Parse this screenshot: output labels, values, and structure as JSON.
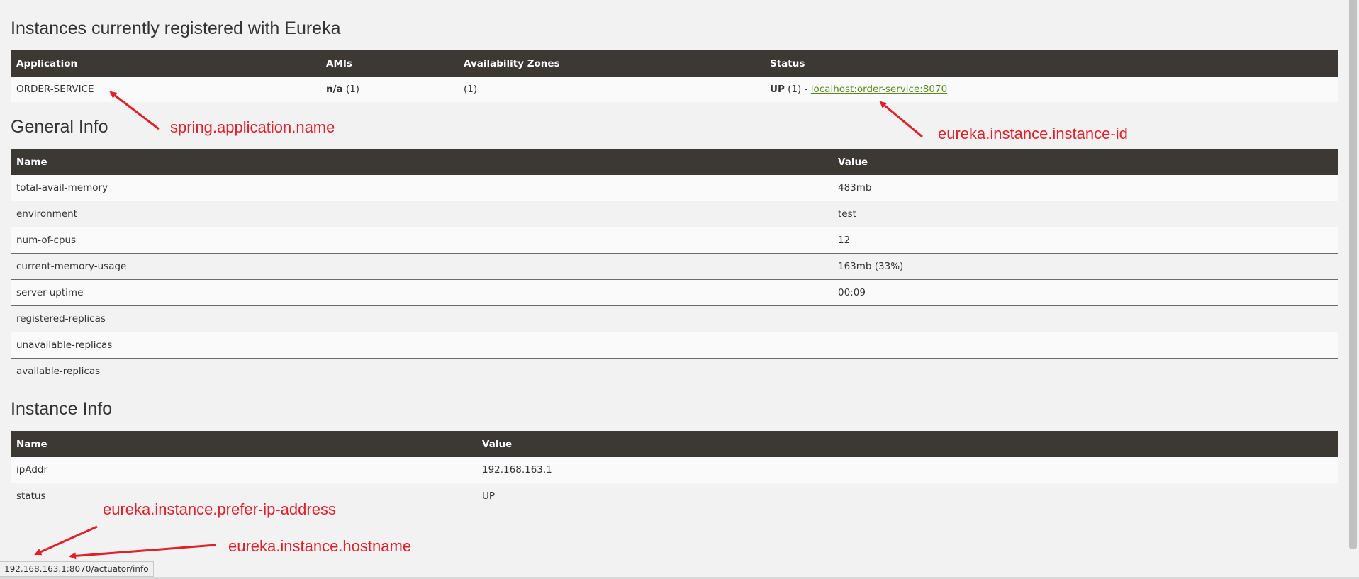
{
  "applications_section": {
    "title": "Instances currently registered with Eureka",
    "headers": [
      "Application",
      "AMIs",
      "Availability Zones",
      "Status"
    ],
    "row": {
      "application": "ORDER-SERVICE",
      "amis_bold": "n/a",
      "amis_count": "(1)",
      "zones": "(1)",
      "status_bold": "UP",
      "status_rest": "(1) -",
      "instance_link": "localhost:order-service:8070"
    }
  },
  "general_info": {
    "title": "General Info",
    "headers": [
      "Name",
      "Value"
    ],
    "rows": [
      {
        "name": "total-avail-memory",
        "value": "483mb"
      },
      {
        "name": "environment",
        "value": "test"
      },
      {
        "name": "num-of-cpus",
        "value": "12"
      },
      {
        "name": "current-memory-usage",
        "value": "163mb (33%)"
      },
      {
        "name": "server-uptime",
        "value": "00:09"
      },
      {
        "name": "registered-replicas",
        "value": ""
      },
      {
        "name": "unavailable-replicas",
        "value": ""
      },
      {
        "name": "available-replicas",
        "value": ""
      }
    ]
  },
  "instance_info": {
    "title": "Instance Info",
    "headers": [
      "Name",
      "Value"
    ],
    "rows": [
      {
        "name": "ipAddr",
        "value": "192.168.163.1"
      },
      {
        "name": "status",
        "value": "UP"
      }
    ]
  },
  "annotations": {
    "app_name": "spring.application.name",
    "instance_id": "eureka.instance.instance-id",
    "prefer_ip": "eureka.instance.prefer-ip-address",
    "hostname": "eureka.instance.hostname"
  },
  "status_bar": {
    "url": "192.168.163.1:8070/actuator/info"
  },
  "colors": {
    "header_bg": "#3c3834",
    "annotation": "#e0202a",
    "link": "#5a8a1f"
  }
}
